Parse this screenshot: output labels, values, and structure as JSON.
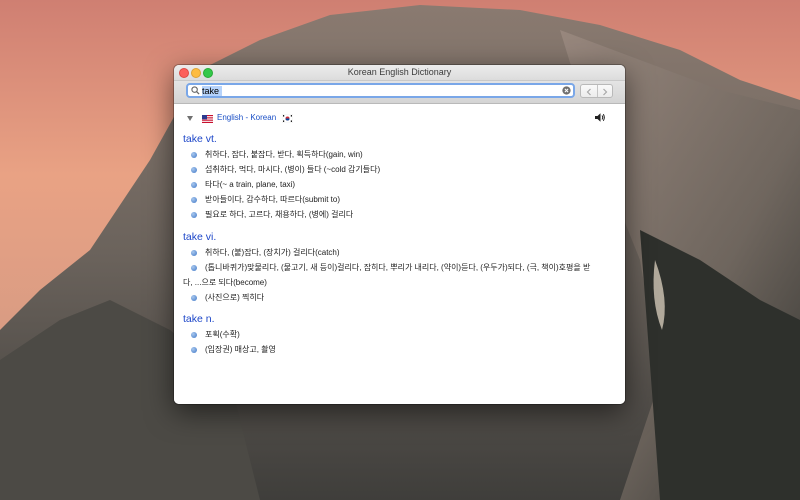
{
  "window": {
    "title": "Korean English Dictionary"
  },
  "search": {
    "value": "take",
    "placeholder": ""
  },
  "dictionary": {
    "name": "English - Korean"
  },
  "sections": [
    {
      "heading": "take vt.",
      "definitions": [
        "취하다, 잡다, 붙잡다, 받다, 획득하다(gain, win)",
        "섭취하다, 먹다, 마시다, (병이) 들다 (~cold 감기들다)",
        "타다(~ a train, plane, taxi)",
        "받아들이다, 감수하다, 따르다(submit to)",
        "필요로 하다, 고르다, 채용하다, (병에) 걸리다"
      ]
    },
    {
      "heading": "take vi.",
      "definitions": [
        "취하다, (붙)잡다, (장치가) 걸리다(catch)",
        {
          "line1": "(톱니바퀴가)맞물리다, (물고기, 새 등이)걸리다, 잡히다, 뿌리가 내리다, (약이)듣다, (우두가)되다, (극, 책이)호평을 받",
          "line2": "다, ...으로 되다(become)"
        },
        "(사진으로) 찍히다"
      ]
    },
    {
      "heading": "take n.",
      "definitions": [
        "포획(수확)",
        "(입장권) 매상고, 촬영"
      ]
    }
  ],
  "icons": {
    "search": "magnifier-icon",
    "clear": "clear-circle-x-icon",
    "back": "chevron-left-icon",
    "forward": "chevron-right-icon",
    "disclosure": "disclosure-triangle-down-icon",
    "flag_en": "us-flag-icon",
    "flag_ko": "korea-flag-icon",
    "speaker": "speaker-icon"
  },
  "colors": {
    "heading": "#1c46c8",
    "link": "#1a4fc6",
    "focus_ring": "#7aa7e8",
    "close": "#fc605b",
    "minimize": "#fdbc40",
    "maximize": "#34c84a"
  }
}
